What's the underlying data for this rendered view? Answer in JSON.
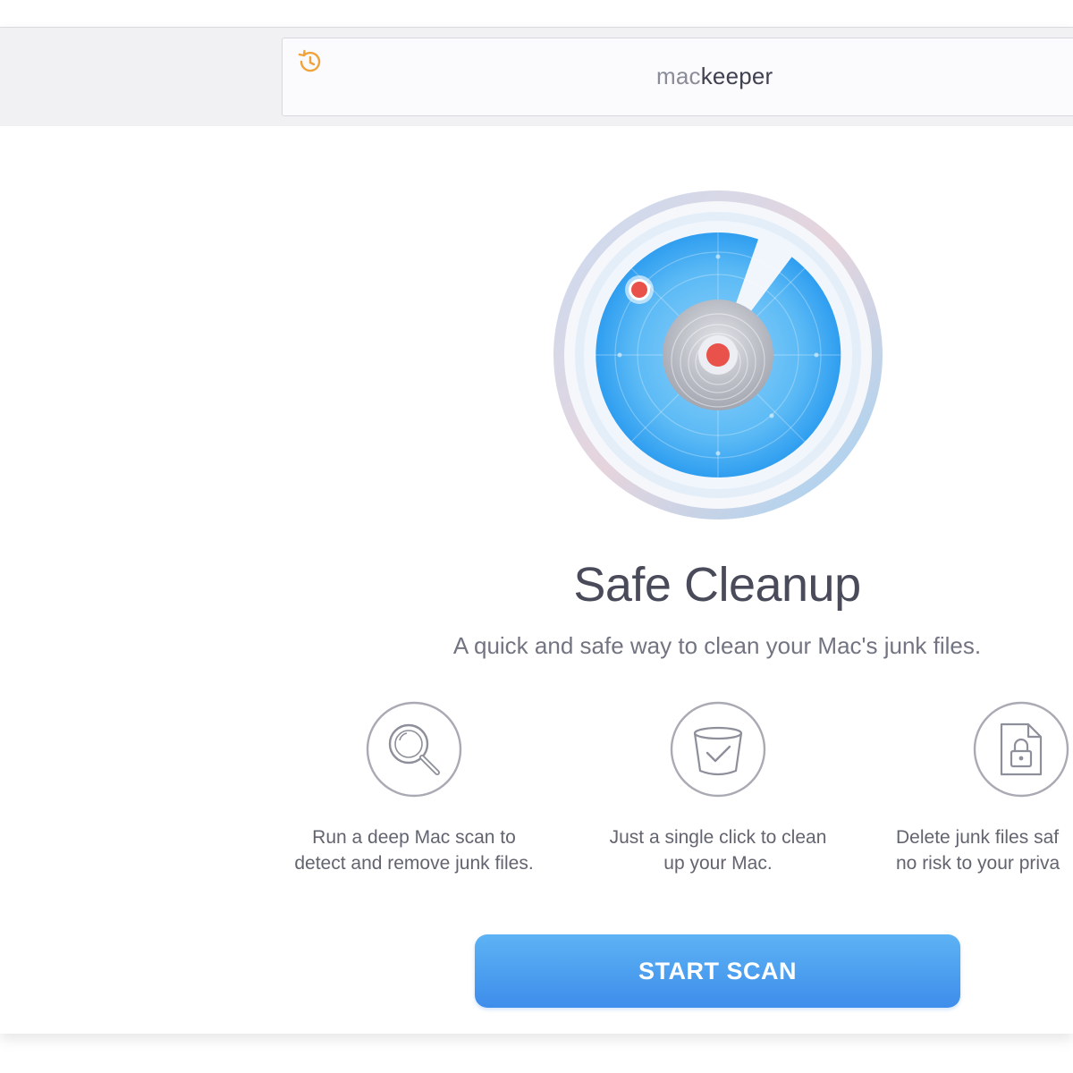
{
  "header": {
    "logo_mac": "mac",
    "logo_keeper": "keeper",
    "history_icon": "history-icon",
    "accent_color": "#f0a33a"
  },
  "main": {
    "title": "Safe Cleanup",
    "subtitle": "A quick and safe way to clean your Mac's junk files.",
    "features": [
      {
        "icon": "magnifier-icon",
        "line1": "Run a deep Mac scan to",
        "line2": "detect and remove junk files."
      },
      {
        "icon": "trash-check-icon",
        "line1": "Just a single click to clean",
        "line2": "up your Mac."
      },
      {
        "icon": "locked-file-icon",
        "line1": "Delete junk files saf",
        "line2": "no risk to your priva"
      }
    ],
    "start_button": "START SCAN",
    "button_color": "#4a9cef"
  }
}
